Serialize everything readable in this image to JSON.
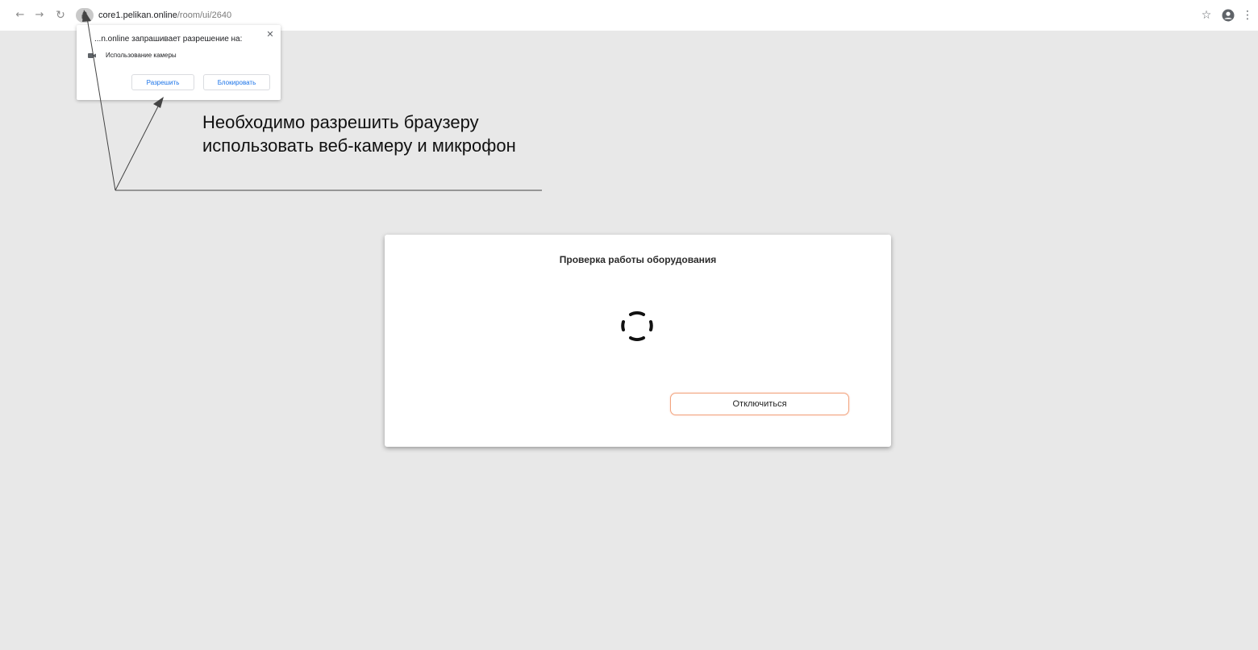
{
  "browser": {
    "url_host": "core1.pelikan.online",
    "url_path": "/room/ui/2640"
  },
  "permission_popup": {
    "title": "...n.online запрашивает разрешение на:",
    "item_label": "Использование камеры",
    "allow_label": "Разрешить",
    "block_label": "Блокировать"
  },
  "annotation": {
    "text": "Необходимо разрешить браузеру использовать веб-камеру и микрофон"
  },
  "check_dialog": {
    "title": "Проверка работы оборудования",
    "disconnect_label": "Отключиться"
  },
  "colors": {
    "page_background": "#e8e8e8",
    "accent_border": "#f2a47f",
    "link_blue": "#1a73e8"
  },
  "icons": {
    "back": "arrow-left-icon",
    "forward": "arrow-right-icon",
    "reload": "reload-icon",
    "lock": "lock-icon",
    "star": "star-icon",
    "account": "account-icon",
    "menu": "kebab-menu-icon",
    "close": "close-icon",
    "camera": "camera-icon",
    "spinner": "loading-spinner-icon"
  }
}
